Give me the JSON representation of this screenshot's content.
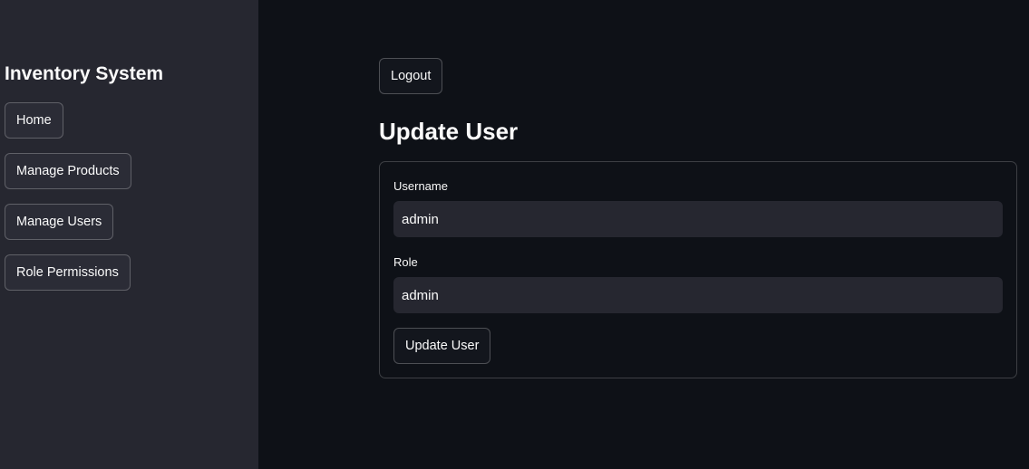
{
  "sidebar": {
    "title": "Inventory System",
    "items": [
      {
        "label": "Home"
      },
      {
        "label": "Manage Products"
      },
      {
        "label": "Manage Users"
      },
      {
        "label": "Role Permissions"
      }
    ]
  },
  "main": {
    "logout_label": "Logout",
    "page_title": "Update User",
    "form": {
      "username_label": "Username",
      "username_value": "admin",
      "role_label": "Role",
      "role_value": "admin",
      "submit_label": "Update User"
    }
  },
  "colors": {
    "sidebar_bg": "#262730",
    "main_bg": "#0e1117",
    "text": "#fafafa",
    "input_bg": "#262730"
  }
}
